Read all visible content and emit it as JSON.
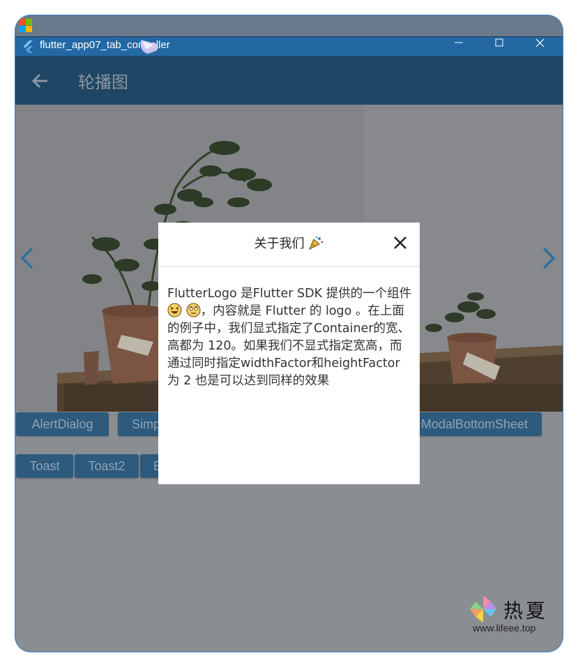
{
  "window": {
    "title": "flutter_app07_tab_controller",
    "controls": [
      "minimize",
      "maximize",
      "close"
    ]
  },
  "appbar": {
    "title": "轮播图",
    "back_icon": "arrow-left-icon"
  },
  "carousel": {
    "prev_icon": "chevron-left-icon",
    "next_icon": "chevron-right-icon"
  },
  "buttons": {
    "row1": [
      "AlertDialog",
      "Simp",
      "ModalBottomSheet"
    ],
    "row2": [
      "Toast",
      "Toast2",
      "B"
    ]
  },
  "dialog": {
    "title": "关于我们",
    "close_icon": "close-icon",
    "body_part1": "FlutterLogo 是Flutter SDK 提供的一个组件",
    "body_part2": "，内容就是 Flutter 的 logo 。在上面的例子中，我们显式指定了Container的宽、高都为 120。如果我们不显式指定宽高，而通过同时指定widthFactor和heightFactor 为 2 也是可以达到同样的效果"
  },
  "watermark": {
    "text": "热夏",
    "url": "www.lifeee.top"
  },
  "colors": {
    "titlebar": "#2368a2",
    "appbar": "#1f4664",
    "overlay": "#8a8d92",
    "button": "#2d5a7d",
    "arrow": "#2f6fa3"
  }
}
